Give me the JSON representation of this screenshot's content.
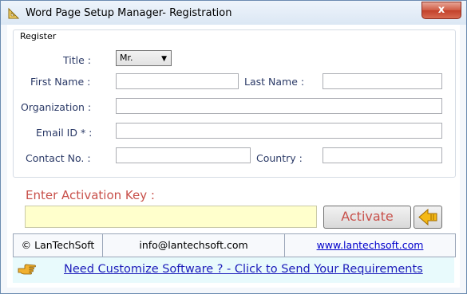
{
  "window": {
    "title": "Word Page Setup Manager- Registration",
    "close_glyph": "x"
  },
  "register": {
    "group_label": "Register",
    "title_label": "Title :",
    "title_value": "Mr.",
    "first_name_label": "First Name :",
    "first_name_value": "",
    "last_name_label": "Last Name :",
    "last_name_value": "",
    "organization_label": "Organization :",
    "organization_value": "",
    "email_label": "Email ID * :",
    "email_value": "",
    "contact_label": "Contact No. :",
    "contact_value": "",
    "country_label": "Country :",
    "country_value": ""
  },
  "activation": {
    "label": "Enter Activation Key  :",
    "key_value": "",
    "activate_label": "Activate"
  },
  "footer": {
    "copyright": "© LanTechSoft",
    "email": "info@lantechsoft.com",
    "website": "www.lantechsoft.com"
  },
  "bottom": {
    "customize_link": "Need Customize Software ? - Click to Send Your Requirements"
  },
  "icons": {
    "app": "setsquare-icon",
    "back": "arrow-left-icon",
    "hand": "pointing-hand-icon"
  }
}
